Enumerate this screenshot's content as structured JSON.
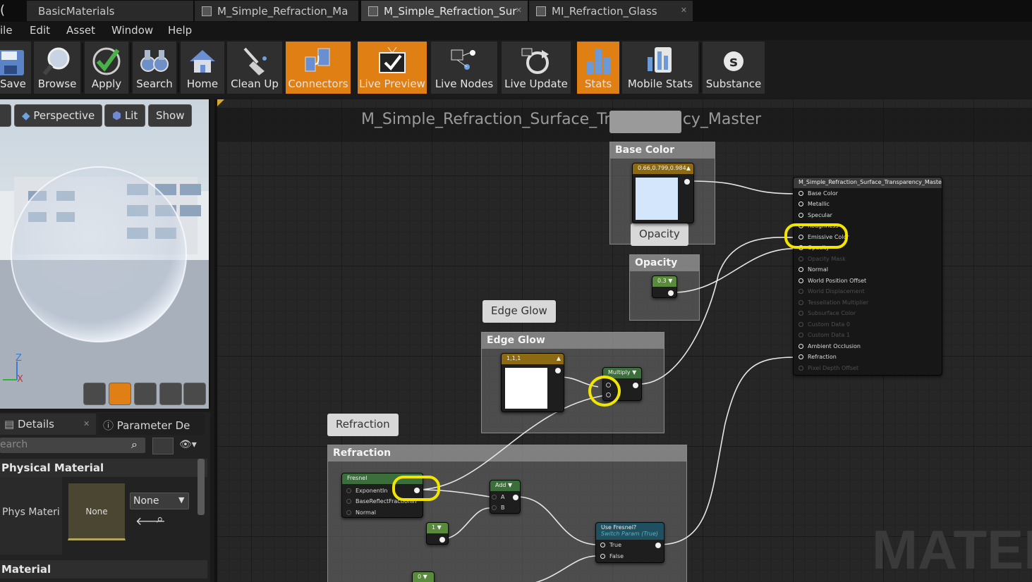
{
  "tabs": [
    {
      "label": "BasicMaterials"
    },
    {
      "label": "M_Simple_Refraction_Ma"
    },
    {
      "label": "M_Simple_Refraction_Sur"
    },
    {
      "label": "MI_Refraction_Glass"
    }
  ],
  "menu": [
    "ile",
    "Edit",
    "Asset",
    "Window",
    "Help"
  ],
  "toolbar": {
    "save": "Save",
    "browse": "Browse",
    "apply": "Apply",
    "search": "Search",
    "home": "Home",
    "cleanup": "Clean Up",
    "connectors": "Connectors",
    "livepreview": "Live Preview",
    "livenodes": "Live Nodes",
    "liveupdate": "Live Update",
    "stats": "Stats",
    "mobilestats": "Mobile Stats",
    "substance": "Substance",
    "active_color": "#e07f14"
  },
  "viewport": {
    "perspective": "Perspective",
    "lit": "Lit",
    "show": "Show",
    "axis_z": "Z",
    "axis_x": "X"
  },
  "details": {
    "tab_details": "Details",
    "tab_params": "Parameter De",
    "search_placeholder": "earch",
    "section_physical": "Physical Material",
    "phys_label": "Phys Materi",
    "phys_thumb": "None",
    "phys_select": "None",
    "section_material": "Material"
  },
  "graph": {
    "title": "M_Simple_Refraction_Surface_Transparency_Master",
    "watermark": "MATERI",
    "comment_base": {
      "bubble": "Base Color",
      "header": "Base Color"
    },
    "comment_opacity": {
      "bubble": "Opacity",
      "header": "Opacity"
    },
    "comment_glow": {
      "bubble": "Edge Glow",
      "header": "Edge Glow"
    },
    "comment_refraction": {
      "bubble": "Refraction",
      "header": "Refraction"
    },
    "node_base_color": {
      "value": "0.66,0.799,0.984",
      "swatch": "#d4e6fb"
    },
    "node_opacity": {
      "value": "0.3"
    },
    "node_glow_color": {
      "value": "1,1,1",
      "swatch": "#ffffff"
    },
    "node_multiply": {
      "title": "Multiply"
    },
    "node_fresnel": {
      "title": "Fresnel",
      "pins": [
        "ExponentIn",
        "BaseReflectFractionIn",
        "Normal"
      ]
    },
    "node_add": {
      "title": "Add",
      "pins": [
        "A",
        "B"
      ]
    },
    "node_one": {
      "value": "1"
    },
    "node_zero": {
      "value": "0"
    },
    "node_switch": {
      "title": "Use Fresnel?",
      "subtitle": "Switch Param (True)",
      "pins": [
        "True",
        "False"
      ]
    },
    "master": {
      "title": "M_Simple_Refraction_Surface_Transparency_Master",
      "pins": [
        {
          "label": "Base Color",
          "active": true
        },
        {
          "label": "Metallic",
          "active": true
        },
        {
          "label": "Specular",
          "active": true
        },
        {
          "label": "Roughness",
          "active": true
        },
        {
          "label": "Emissive Color",
          "active": true
        },
        {
          "label": "Opacity",
          "active": true
        },
        {
          "label": "Opacity Mask",
          "active": false
        },
        {
          "label": "Normal",
          "active": true
        },
        {
          "label": "World Position Offset",
          "active": true
        },
        {
          "label": "World Displacement",
          "active": false
        },
        {
          "label": "Tessellation Multiplier",
          "active": false
        },
        {
          "label": "Subsurface Color",
          "active": false
        },
        {
          "label": "Custom Data 0",
          "active": false
        },
        {
          "label": "Custom Data 1",
          "active": false
        },
        {
          "label": "Ambient Occlusion",
          "active": true
        },
        {
          "label": "Refraction",
          "active": true
        },
        {
          "label": "Pixel Depth Offset",
          "active": false
        }
      ]
    }
  }
}
